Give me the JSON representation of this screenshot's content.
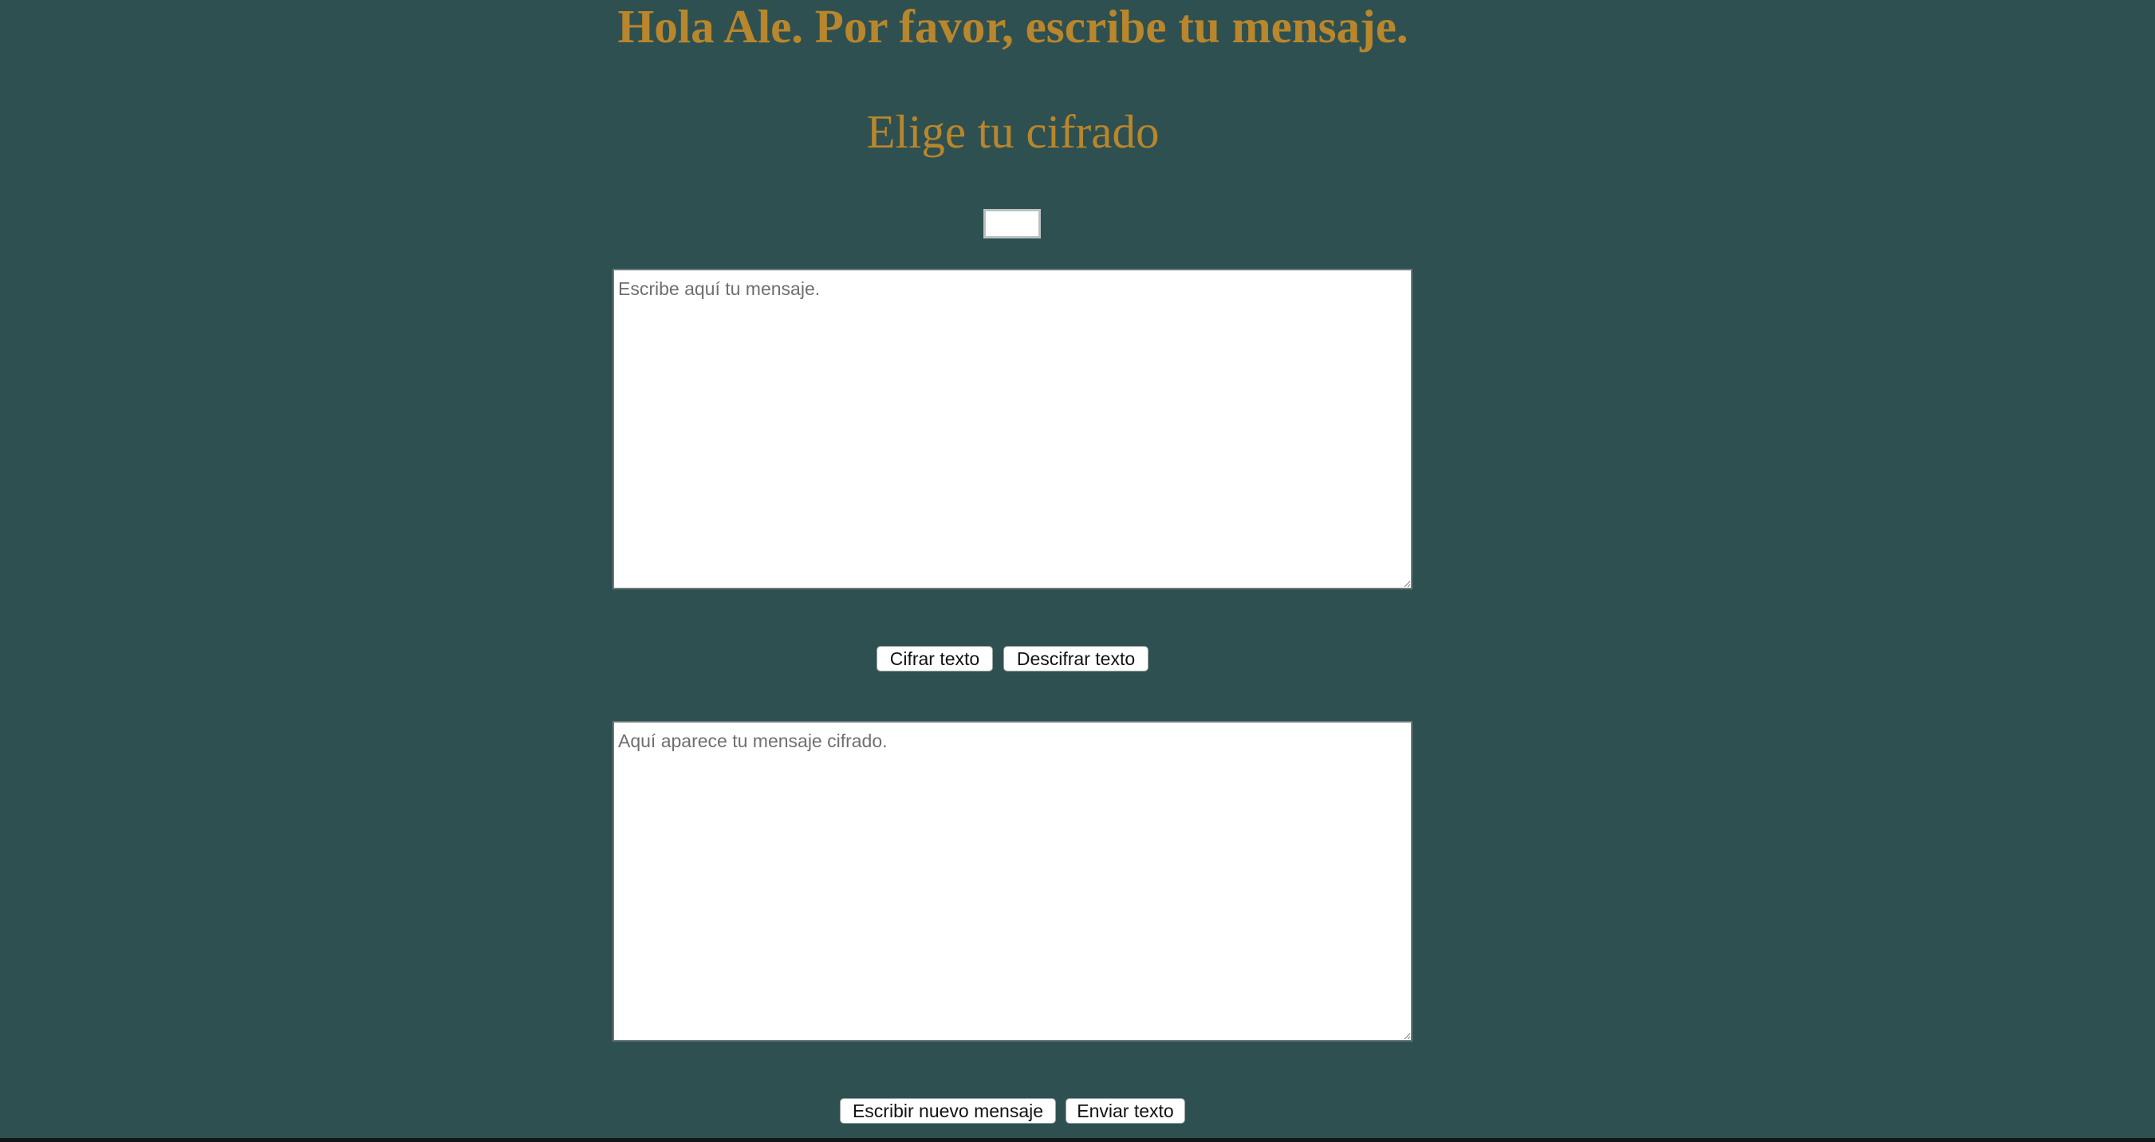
{
  "header": {
    "title": "Hola Ale. Por favor, escribe tu mensaje.",
    "subtitle": "Elige tu cifrado"
  },
  "offset_input": {
    "value": ""
  },
  "message_input": {
    "placeholder": "Escribe aquí tu mensaje.",
    "value": ""
  },
  "cipher_actions": {
    "encrypt_label": "Cifrar texto",
    "decrypt_label": "Descifrar texto"
  },
  "message_output": {
    "placeholder": "Aquí aparece tu mensaje cifrado.",
    "value": ""
  },
  "footer_actions": {
    "new_message_label": "Escribir nuevo mensaje",
    "send_label": "Enviar texto"
  },
  "colors": {
    "background": "#2f5050",
    "heading": "#b8862c"
  }
}
